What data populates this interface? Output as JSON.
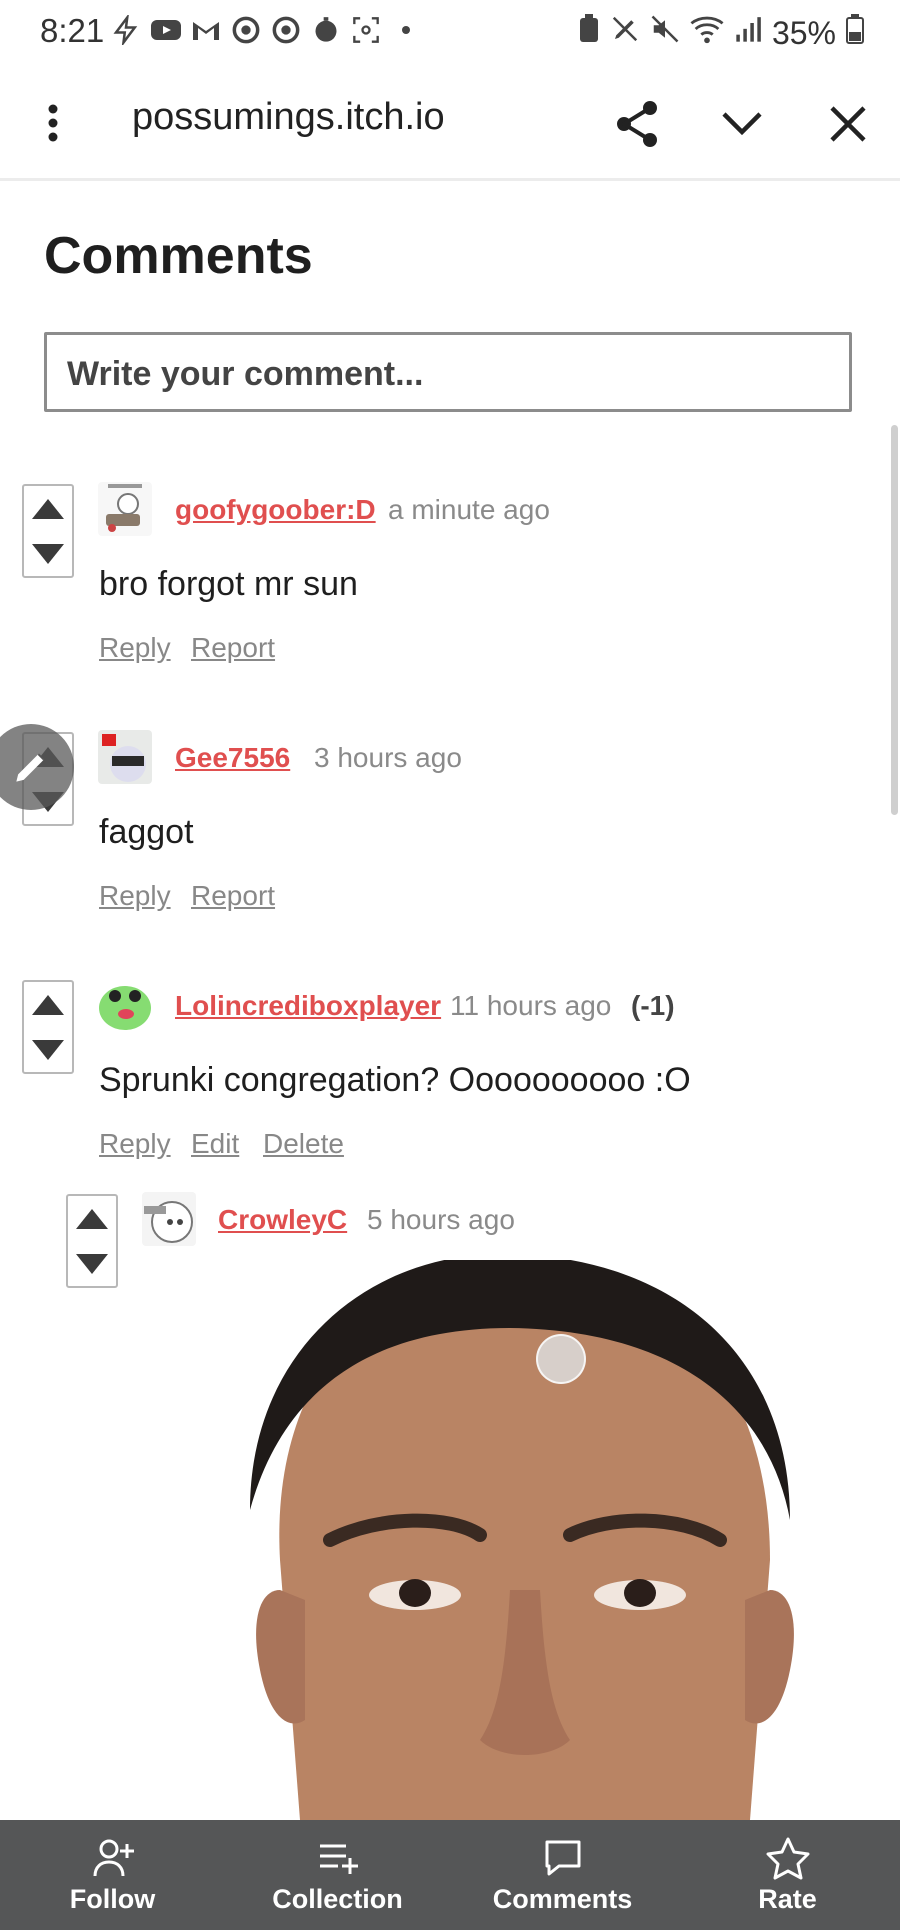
{
  "status_bar": {
    "time": "8:21",
    "battery": "35%",
    "left_icons": [
      "flash-icon",
      "youtube-icon",
      "gmail-icon",
      "chrome-icon",
      "chrome-icon",
      "timer-icon",
      "screenshot-icon",
      "dot-icon"
    ],
    "right_icons": [
      "battery-saver-icon",
      "pen-icon",
      "mute-icon",
      "wifi-icon",
      "signal-icon",
      "battery-icon"
    ]
  },
  "app_bar": {
    "url": "possumings.itch.io",
    "icons": [
      "menu-icon",
      "share-icon",
      "chevron-down-icon",
      "close-icon"
    ]
  },
  "comments": {
    "title": "Comments",
    "input_placeholder": "Write your comment...",
    "items": [
      {
        "username": "goofygoober:D",
        "time": "a minute ago",
        "text": "bro forgot mr sun",
        "actions": [
          "Reply",
          "Report"
        ]
      },
      {
        "username": "Gee7556",
        "time": "3 hours ago",
        "text": "faggot",
        "actions": [
          "Reply",
          "Report"
        ]
      },
      {
        "username": "Lolincrediboxplayer",
        "time": "11 hours ago",
        "score": "(-1)",
        "text": "Sprunki congregation? Oooooooooo :O",
        "actions": [
          "Reply",
          "Edit",
          "Delete"
        ]
      },
      {
        "username": "CrowleyC",
        "time": "5 hours ago",
        "text": ""
      }
    ]
  },
  "bottom_nav": {
    "items": [
      {
        "label": "Follow",
        "icon": "add-user-icon"
      },
      {
        "label": "Collection",
        "icon": "add-to-list-icon"
      },
      {
        "label": "Comments",
        "icon": "comment-icon"
      },
      {
        "label": "Rate",
        "icon": "star-icon"
      }
    ]
  },
  "colors": {
    "username": "#e04f4f",
    "bottom_bar": "#555657",
    "timestamp": "#8a8a8a"
  }
}
